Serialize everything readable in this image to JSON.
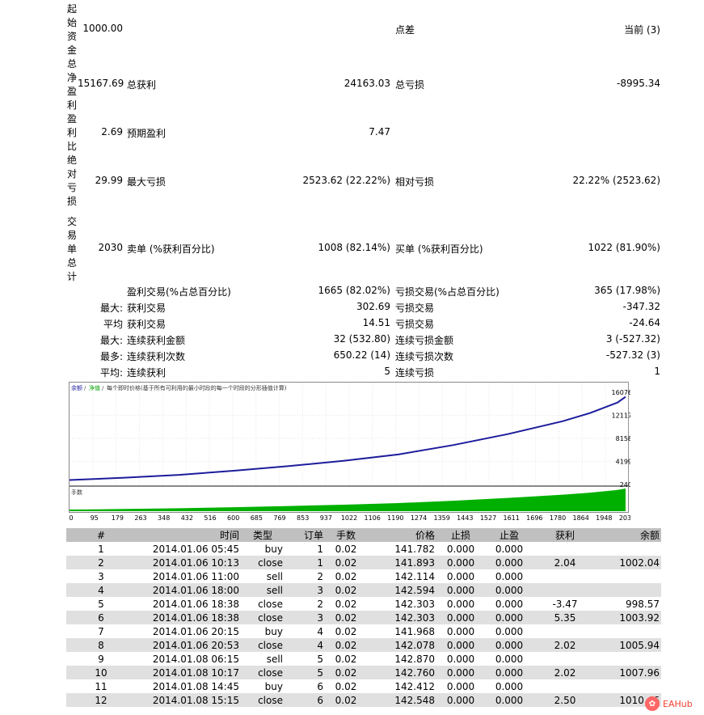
{
  "summary": {
    "initial_deposit": {
      "label": "起始资金",
      "value": "1000.00",
      "mid_label": "点差",
      "right_value": "当前 (3)"
    },
    "net_profit": {
      "label": "总净盈利",
      "value": "15167.69",
      "label2": "总获利",
      "value2": "24163.03",
      "label3": "总亏损",
      "value3": "-8995.34"
    },
    "profit_factor": {
      "label": "盈利比",
      "value": "2.69",
      "label2": "预期盈利",
      "value2": "7.47"
    },
    "drawdown": {
      "label": "绝对亏损",
      "value": "29.99",
      "label2": "最大亏损",
      "value2": "2523.62 (22.22%)",
      "label3": "相对亏损",
      "value3": "22.22% (2523.62)"
    },
    "trades": {
      "label": "交易单总计",
      "value": "2030",
      "label2": "卖单 (%获利百分比)",
      "value2": "1008 (82.14%)",
      "label3": "买单 (%获利百分比)",
      "value3": "1022 (81.90%)"
    }
  },
  "stats_rows": [
    {
      "prefix": "",
      "l1": "盈利交易(%占总百分比)",
      "v1": "1665 (82.02%)",
      "l2": "亏损交易(%占总百分比)",
      "v2": "365 (17.98%)"
    },
    {
      "prefix": "最大:",
      "l1": "获利交易",
      "v1": "302.69",
      "l2": "亏损交易",
      "v2": "-347.32"
    },
    {
      "prefix": "平均",
      "l1": "获利交易",
      "v1": "14.51",
      "l2": "亏损交易",
      "v2": "-24.64"
    },
    {
      "prefix": "最大:",
      "l1": "连续获利金额",
      "v1": "32 (532.80)",
      "l2": "连续亏损金额",
      "v2": "3 (-527.32)"
    },
    {
      "prefix": "最多:",
      "l1": "连续获利次数",
      "v1": "650.22 (14)",
      "l2": "连续亏损次数",
      "v2": "-527.32 (3)"
    },
    {
      "prefix": "平均:",
      "l1": "连续获利",
      "v1": "5",
      "l2": "连续亏损",
      "v2": "1"
    }
  ],
  "chart_data": {
    "type": "line",
    "legend": {
      "balance": "余额",
      "equity": "净值",
      "note": "每个即时价格(基于所有可利用的最小时段的每一个时段的分形插值计算)"
    },
    "lot_label": "手数",
    "y_ticks": [
      "16076",
      "12117",
      "8158",
      "4199",
      "240"
    ],
    "x_ticks": [
      "0",
      "95",
      "179",
      "263",
      "348",
      "432",
      "516",
      "600",
      "685",
      "769",
      "853",
      "937",
      "1022",
      "1106",
      "1190",
      "1274",
      "1359",
      "1443",
      "1527",
      "1611",
      "1696",
      "1780",
      "1864",
      "1948",
      "2033"
    ],
    "x": [
      0,
      200,
      400,
      600,
      800,
      1000,
      1200,
      1400,
      1600,
      1800,
      1900,
      2000,
      2030
    ],
    "balance": [
      1000,
      1400,
      1900,
      2600,
      3400,
      4300,
      5400,
      7000,
      8900,
      11100,
      12500,
      14300,
      15300
    ],
    "ylim": [
      240,
      16076
    ],
    "xlim": [
      0,
      2030
    ],
    "colors": {
      "balance": "#1c1c9c",
      "equity": "#00a000",
      "lots": "#00b000"
    }
  },
  "table": {
    "headers": [
      "#",
      "时间",
      "类型",
      "订单",
      "手数",
      "价格",
      "止损",
      "止盈",
      "获利",
      "余额"
    ],
    "rows": [
      [
        "1",
        "2014.01.06 05:45",
        "buy",
        "1",
        "0.02",
        "141.782",
        "0.000",
        "0.000",
        "",
        ""
      ],
      [
        "2",
        "2014.01.06 10:13",
        "close",
        "1",
        "0.02",
        "141.893",
        "0.000",
        "0.000",
        "2.04",
        "1002.04"
      ],
      [
        "3",
        "2014.01.06 11:00",
        "sell",
        "2",
        "0.02",
        "142.114",
        "0.000",
        "0.000",
        "",
        ""
      ],
      [
        "4",
        "2014.01.06 18:00",
        "sell",
        "3",
        "0.02",
        "142.594",
        "0.000",
        "0.000",
        "",
        ""
      ],
      [
        "5",
        "2014.01.06 18:38",
        "close",
        "2",
        "0.02",
        "142.303",
        "0.000",
        "0.000",
        "-3.47",
        "998.57"
      ],
      [
        "6",
        "2014.01.06 18:38",
        "close",
        "3",
        "0.02",
        "142.303",
        "0.000",
        "0.000",
        "5.35",
        "1003.92"
      ],
      [
        "7",
        "2014.01.06 20:15",
        "buy",
        "4",
        "0.02",
        "141.968",
        "0.000",
        "0.000",
        "",
        ""
      ],
      [
        "8",
        "2014.01.06 20:53",
        "close",
        "4",
        "0.02",
        "142.078",
        "0.000",
        "0.000",
        "2.02",
        "1005.94"
      ],
      [
        "9",
        "2014.01.08 06:15",
        "sell",
        "5",
        "0.02",
        "142.870",
        "0.000",
        "0.000",
        "",
        ""
      ],
      [
        "10",
        "2014.01.08 10:17",
        "close",
        "5",
        "0.02",
        "142.760",
        "0.000",
        "0.000",
        "2.02",
        "1007.96"
      ],
      [
        "11",
        "2014.01.08 14:45",
        "buy",
        "6",
        "0.02",
        "142.412",
        "0.000",
        "0.000",
        "",
        ""
      ],
      [
        "12",
        "2014.01.08 15:15",
        "close",
        "6",
        "0.02",
        "142.548",
        "0.000",
        "0.000",
        "2.50",
        "1010.46"
      ]
    ]
  },
  "watermark": "EAHub"
}
